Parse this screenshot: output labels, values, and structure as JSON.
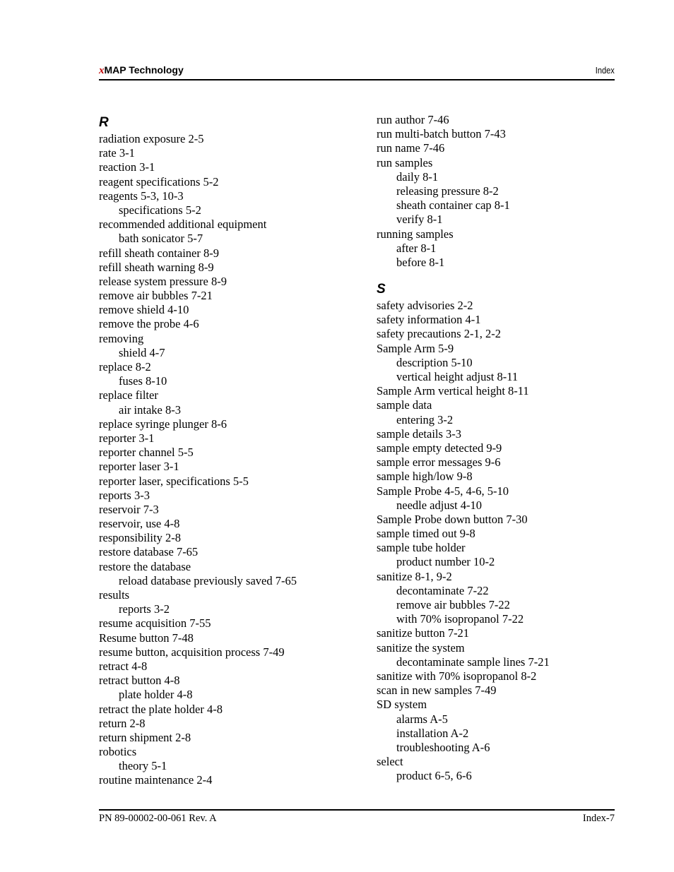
{
  "header": {
    "brand_prefix": "x",
    "brand_rest": "MAP Technology",
    "section": "Index"
  },
  "left_column": {
    "letter": "R",
    "entries": [
      {
        "text": "radiation exposure 2-5",
        "level": 0
      },
      {
        "text": "rate 3-1",
        "level": 0
      },
      {
        "text": "reaction 3-1",
        "level": 0
      },
      {
        "text": "reagent specifications 5-2",
        "level": 0
      },
      {
        "text": "reagents 5-3, 10-3",
        "level": 0
      },
      {
        "text": "specifications 5-2",
        "level": 1
      },
      {
        "text": "recommended additional equipment",
        "level": 0
      },
      {
        "text": "bath sonicator 5-7",
        "level": 1
      },
      {
        "text": "refill sheath container 8-9",
        "level": 0
      },
      {
        "text": "refill sheath warning 8-9",
        "level": 0
      },
      {
        "text": "release system pressure 8-9",
        "level": 0
      },
      {
        "text": "remove air bubbles 7-21",
        "level": 0
      },
      {
        "text": "remove shield 4-10",
        "level": 0
      },
      {
        "text": "remove the probe 4-6",
        "level": 0
      },
      {
        "text": "removing",
        "level": 0
      },
      {
        "text": "shield 4-7",
        "level": 1
      },
      {
        "text": "replace 8-2",
        "level": 0
      },
      {
        "text": "fuses 8-10",
        "level": 1
      },
      {
        "text": "replace filter",
        "level": 0
      },
      {
        "text": "air intake 8-3",
        "level": 1
      },
      {
        "text": "replace syringe plunger 8-6",
        "level": 0
      },
      {
        "text": "reporter 3-1",
        "level": 0
      },
      {
        "text": "reporter channel 5-5",
        "level": 0
      },
      {
        "text": "reporter laser 3-1",
        "level": 0
      },
      {
        "text": "reporter laser, specifications 5-5",
        "level": 0
      },
      {
        "text": "reports 3-3",
        "level": 0
      },
      {
        "text": "reservoir 7-3",
        "level": 0
      },
      {
        "text": "reservoir, use 4-8",
        "level": 0
      },
      {
        "text": "responsibility 2-8",
        "level": 0
      },
      {
        "text": "restore database 7-65",
        "level": 0
      },
      {
        "text": "restore the database",
        "level": 0
      },
      {
        "text": "reload database previously saved 7-65",
        "level": 1
      },
      {
        "text": "results",
        "level": 0
      },
      {
        "text": "reports 3-2",
        "level": 1
      },
      {
        "text": "resume acquisition 7-55",
        "level": 0
      },
      {
        "text": "Resume button 7-48",
        "level": 0
      },
      {
        "text": "resume button, acquisition process 7-49",
        "level": 0
      },
      {
        "text": "retract 4-8",
        "level": 0
      },
      {
        "text": "retract button 4-8",
        "level": 0
      },
      {
        "text": "plate holder 4-8",
        "level": 1
      },
      {
        "text": "retract the plate holder 4-8",
        "level": 0
      },
      {
        "text": "return 2-8",
        "level": 0
      },
      {
        "text": "return shipment 2-8",
        "level": 0
      },
      {
        "text": "robotics",
        "level": 0
      },
      {
        "text": "theory 5-1",
        "level": 1
      },
      {
        "text": "routine maintenance 2-4",
        "level": 0
      }
    ]
  },
  "right_column": {
    "r_continued": [
      {
        "text": "run author 7-46",
        "level": 0
      },
      {
        "text": "run multi-batch button 7-43",
        "level": 0
      },
      {
        "text": "run name 7-46",
        "level": 0
      },
      {
        "text": "run samples",
        "level": 0
      },
      {
        "text": "daily 8-1",
        "level": 1
      },
      {
        "text": "releasing pressure 8-2",
        "level": 1
      },
      {
        "text": "sheath container cap 8-1",
        "level": 1
      },
      {
        "text": "verify 8-1",
        "level": 1
      },
      {
        "text": "running samples",
        "level": 0
      },
      {
        "text": "after 8-1",
        "level": 1
      },
      {
        "text": "before 8-1",
        "level": 1
      }
    ],
    "letter": "S",
    "entries": [
      {
        "text": "safety advisories 2-2",
        "level": 0
      },
      {
        "text": "safety information 4-1",
        "level": 0
      },
      {
        "text": "safety precautions 2-1, 2-2",
        "level": 0
      },
      {
        "text": "Sample Arm 5-9",
        "level": 0
      },
      {
        "text": "description 5-10",
        "level": 1
      },
      {
        "text": "vertical height adjust 8-11",
        "level": 1
      },
      {
        "text": "Sample Arm vertical height 8-11",
        "level": 0
      },
      {
        "text": "sample data",
        "level": 0
      },
      {
        "text": "entering 3-2",
        "level": 1
      },
      {
        "text": "sample details 3-3",
        "level": 0
      },
      {
        "text": "sample empty detected 9-9",
        "level": 0
      },
      {
        "text": "sample error messages 9-6",
        "level": 0
      },
      {
        "text": "sample high/low 9-8",
        "level": 0
      },
      {
        "text": "Sample Probe 4-5, 4-6, 5-10",
        "level": 0
      },
      {
        "text": "needle adjust 4-10",
        "level": 1
      },
      {
        "text": "Sample Probe down button 7-30",
        "level": 0
      },
      {
        "text": "sample timed out 9-8",
        "level": 0
      },
      {
        "text": "sample tube holder",
        "level": 0
      },
      {
        "text": "product number 10-2",
        "level": 1
      },
      {
        "text": "sanitize 8-1, 9-2",
        "level": 0
      },
      {
        "text": "decontaminate 7-22",
        "level": 1
      },
      {
        "text": "remove air bubbles 7-22",
        "level": 1
      },
      {
        "text": "with 70% isopropanol 7-22",
        "level": 1
      },
      {
        "text": "sanitize button 7-21",
        "level": 0
      },
      {
        "text": "sanitize the system",
        "level": 0
      },
      {
        "text": "decontaminate sample lines 7-21",
        "level": 1
      },
      {
        "text": "sanitize with 70% isopropanol 8-2",
        "level": 0
      },
      {
        "text": "scan in new samples 7-49",
        "level": 0
      },
      {
        "text": "SD system",
        "level": 0
      },
      {
        "text": "alarms A-5",
        "level": 1
      },
      {
        "text": "installation A-2",
        "level": 1
      },
      {
        "text": "troubleshooting A-6",
        "level": 1
      },
      {
        "text": "select",
        "level": 0
      },
      {
        "text": "product 6-5, 6-6",
        "level": 1
      }
    ]
  },
  "footer": {
    "part_number": "PN 89-00002-00-061 Rev. A",
    "page": "Index-7"
  }
}
